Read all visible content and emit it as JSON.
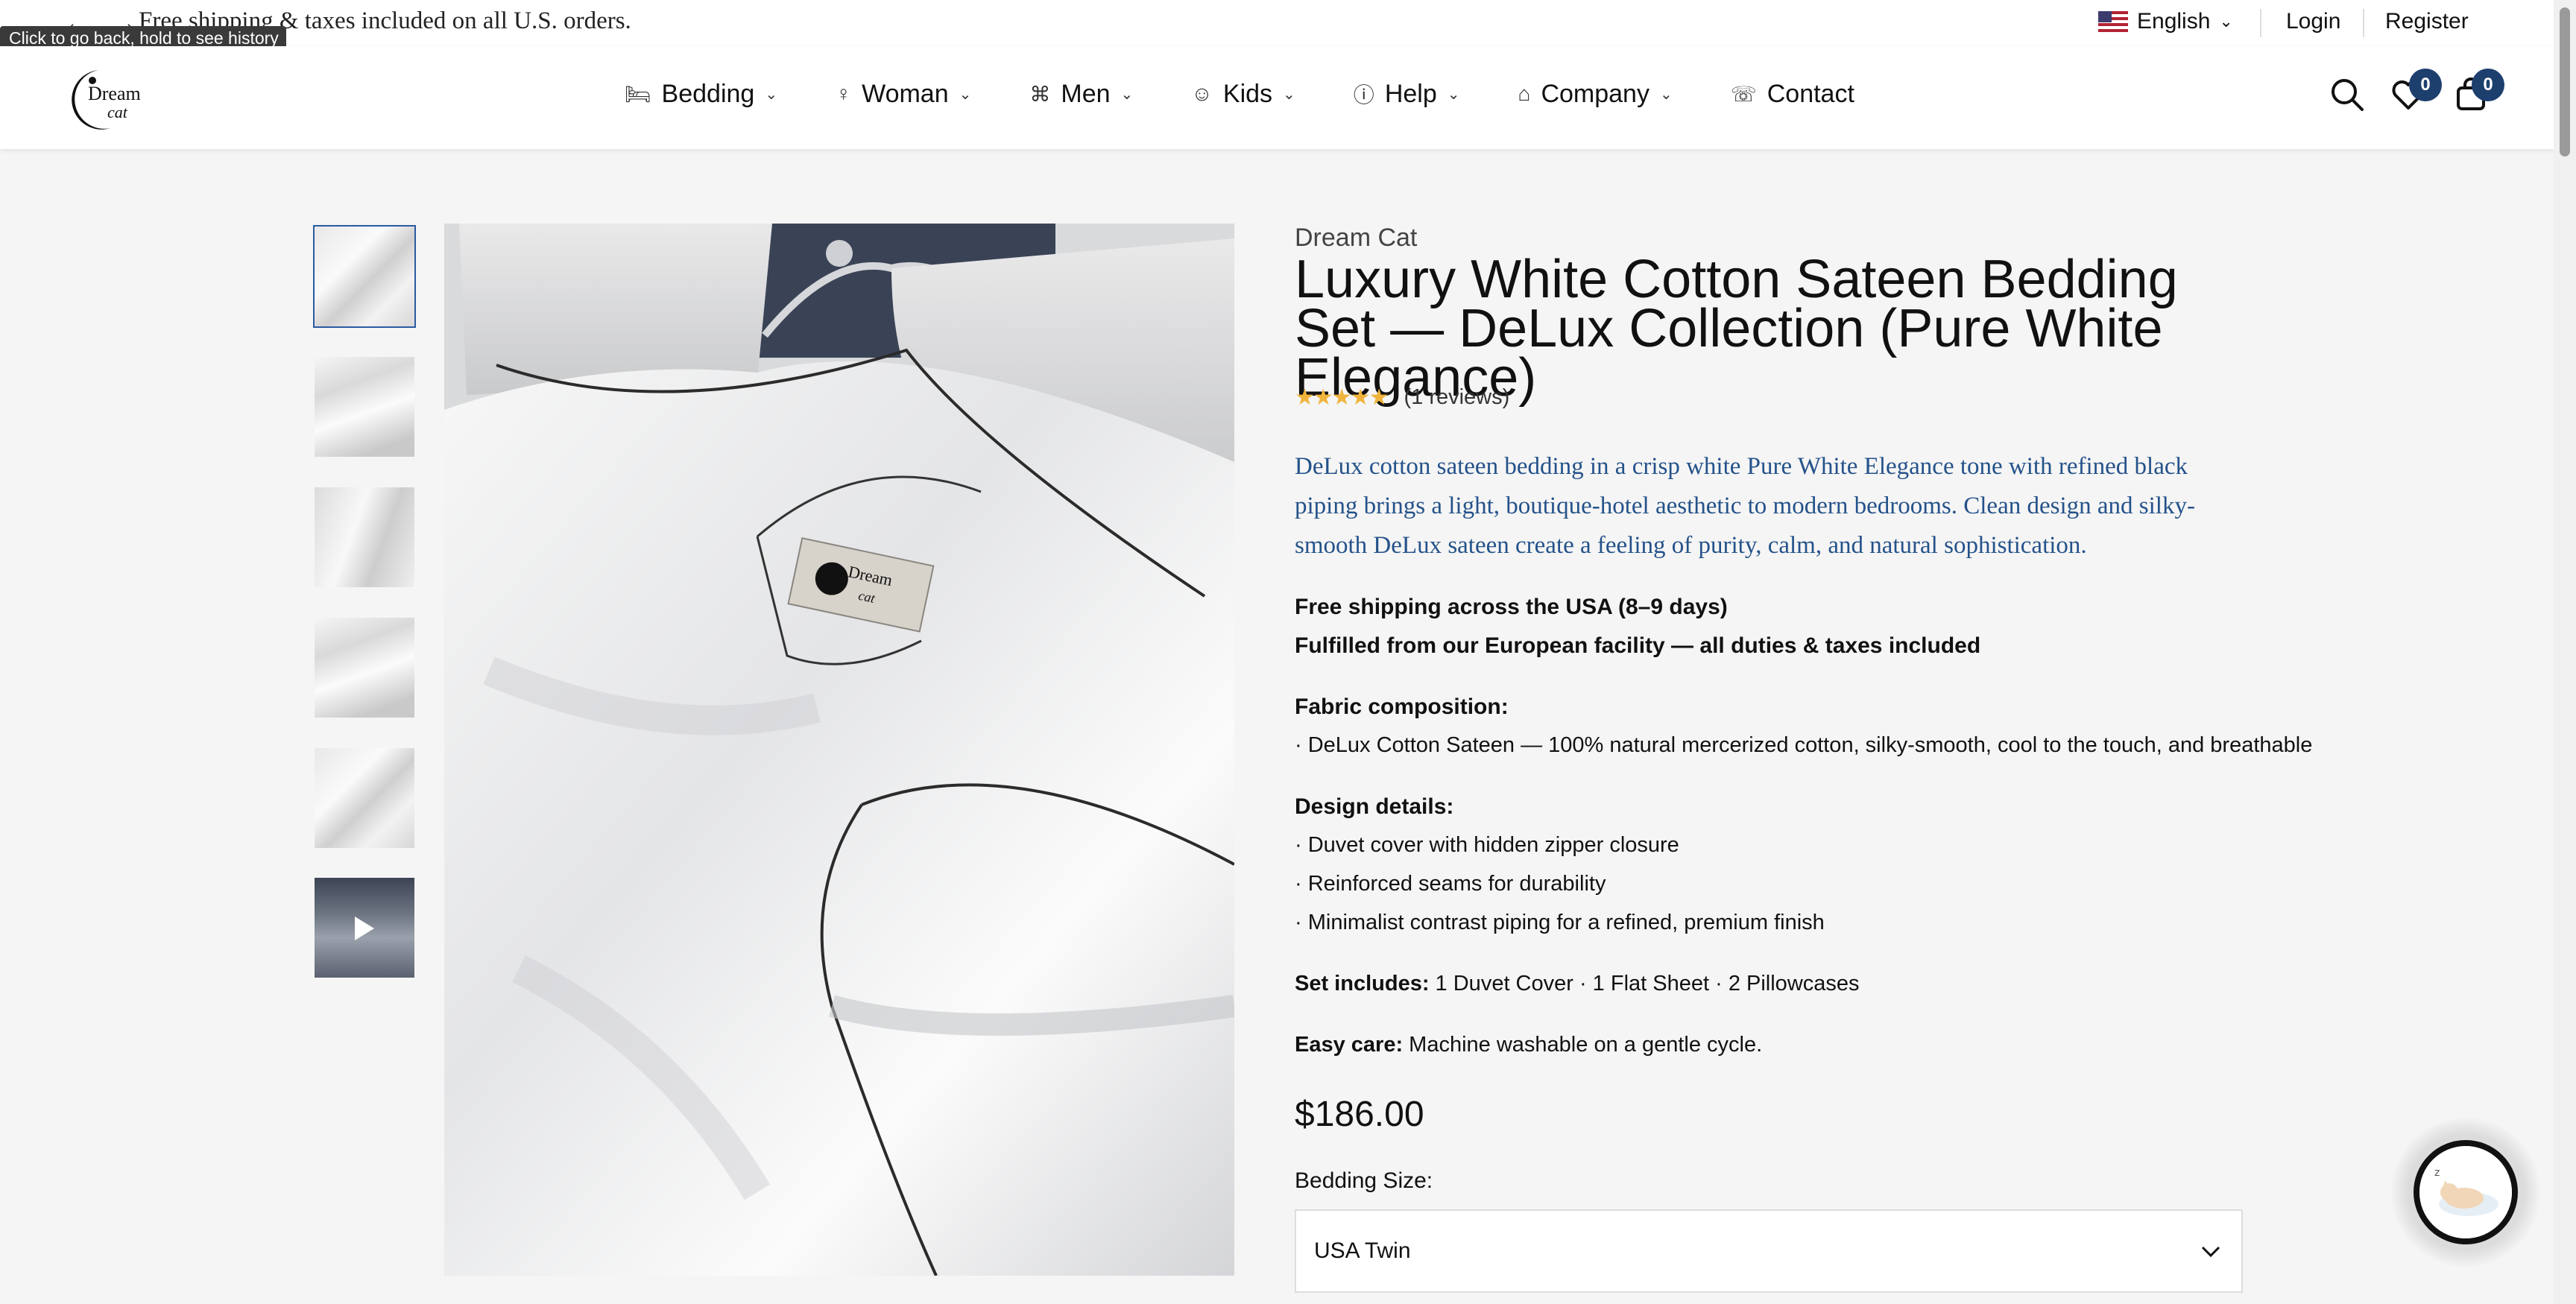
{
  "announcement": {
    "text": "Free shipping & taxes included on all U.S. orders.",
    "back_icon": "arrow-left-icon",
    "forward_icon": "arrow-right-icon",
    "tooltip": "Click to go back, hold to see history"
  },
  "top_links": {
    "language": "English",
    "login": "Login",
    "register": "Register"
  },
  "nav": {
    "items": [
      {
        "label": "Bedding",
        "icon": "bed-icon"
      },
      {
        "label": "Woman",
        "icon": "woman-icon"
      },
      {
        "label": "Men",
        "icon": "men-icon"
      },
      {
        "label": "Kids",
        "icon": "smiley-icon"
      },
      {
        "label": "Help",
        "icon": "help-circle-icon"
      },
      {
        "label": "Company",
        "icon": "building-icon"
      },
      {
        "label": "Contact",
        "icon": "chat-icon"
      }
    ],
    "wishlist_count": "0",
    "cart_count": "0"
  },
  "logo": {
    "text_top": "Dream",
    "text_bottom": "cat"
  },
  "product": {
    "brand": "Dream Cat",
    "title": "Luxury White Cotton Sateen Bedding Set — DeLux Collection (Pure White Elegance)",
    "rating_stars": "★★★★★",
    "reviews": "(1 reviews)",
    "description": "DeLux cotton sateen bedding in a crisp white Pure White Elegance tone with refined black piping brings a light, boutique-hotel aesthetic to modern bedrooms. Clean design and silky-smooth DeLux sateen create a feeling of purity, calm, and natural sophistication.",
    "shipping_line1": "Free shipping across the USA (8–9 days)",
    "shipping_line2": "Fulfilled from our European facility — all duties & taxes included",
    "fabric_heading": "Fabric composition:",
    "fabric_item": "· DeLux Cotton Sateen — 100% natural mercerized cotton, silky-smooth, cool to the touch, and breathable",
    "design_heading": "Design details:",
    "design_items": [
      "· Duvet cover with hidden zipper closure",
      "· Reinforced seams for durability",
      "· Minimalist contrast piping for a refined, premium finish"
    ],
    "set_label": "Set includes:",
    "set_value": " 1 Duvet Cover · 1 Flat Sheet · 2 Pillowcases",
    "care_label": "Easy care:",
    "care_value": " Machine washable on a gentle cycle.",
    "price": "$186.00",
    "size_label": "Bedding Size:",
    "size_selected": "USA Twin"
  },
  "gallery": {
    "thumbnails": [
      "image-1",
      "image-2",
      "image-3",
      "image-4",
      "image-5",
      "video"
    ],
    "active_index": 0,
    "main_image_label_top": "Dream",
    "main_image_label_bottom": "cat"
  },
  "colors": {
    "accent": "#1d3f6e",
    "description_text": "#24528a",
    "star": "#f0b43c"
  }
}
